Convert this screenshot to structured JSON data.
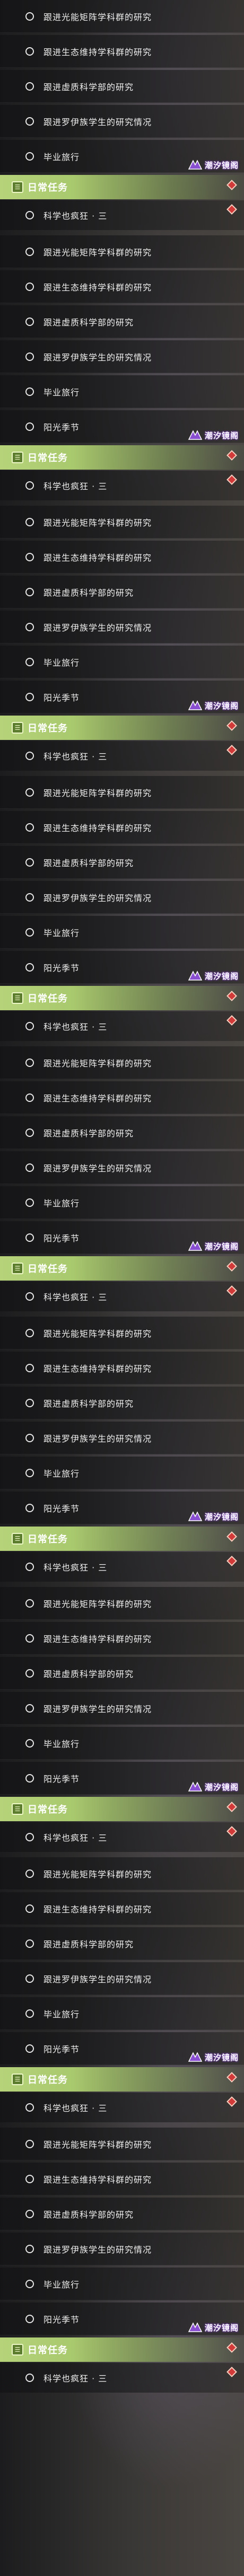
{
  "blocks": [
    {
      "tasks": [
        "跟进光能矩阵学科群的研究",
        "跟进生态维持学科群的研究",
        "跟进虚质科学部的研究",
        "跟进罗伊族学生的研究情况",
        "毕业旅行"
      ],
      "header": {
        "icon": "task-book-icon",
        "title": "日常任务"
      },
      "subtask": "科学也疯狂 · 三",
      "watermark": "潮汐镜阁",
      "show_spring": false
    },
    {
      "tasks": [
        "跟进光能矩阵学科群的研究",
        "跟进生态维持学科群的研究",
        "跟进虚质科学部的研究",
        "跟进罗伊族学生的研究情况",
        "毕业旅行",
        "阳光季节"
      ],
      "header": {
        "icon": "task-book-icon",
        "title": "日常任务"
      },
      "subtask": "科学也疯狂 · 三",
      "watermark": "潮汐镜阁",
      "show_spring": true
    },
    {
      "tasks": [
        "跟进光能矩阵学科群的研究",
        "跟进生态维持学科群的研究",
        "跟进虚质科学部的研究",
        "跟进罗伊族学生的研究情况",
        "毕业旅行",
        "阳光季节"
      ],
      "header": {
        "icon": "task-book-icon",
        "title": "日常任务"
      },
      "subtask": "科学也疯狂 · 三",
      "watermark": "潮汐镜阁",
      "show_spring": true
    },
    {
      "tasks": [
        "跟进光能矩阵学科群的研究",
        "跟进生态维持学科群的研究",
        "跟进虚质科学部的研究",
        "跟进罗伊族学生的研究情况",
        "毕业旅行",
        "阳光季节"
      ],
      "header": {
        "icon": "task-book-icon",
        "title": "日常任务"
      },
      "subtask": "科学也疯狂 · 三",
      "watermark": "潮汐镜阁",
      "show_spring": true
    },
    {
      "tasks": [
        "跟进光能矩阵学科群的研究",
        "跟进生态维持学科群的研究",
        "跟进虚质科学部的研究",
        "跟进罗伊族学生的研究情况",
        "毕业旅行",
        "阳光季节"
      ],
      "header": {
        "icon": "task-book-icon",
        "title": "日常任务"
      },
      "subtask": "科学也疯狂 · 三",
      "watermark": "潮汐镜阁",
      "show_spring": true
    },
    {
      "tasks": [
        "跟进光能矩阵学科群的研究",
        "跟进生态维持学科群的研究",
        "跟进虚质科学部的研究",
        "跟进罗伊族学生的研究情况",
        "毕业旅行",
        "阳光季节"
      ],
      "header": {
        "icon": "task-book-icon",
        "title": "日常任务"
      },
      "subtask": "科学也疯狂 · 三",
      "watermark": "潮汐镜阁",
      "show_spring": true
    },
    {
      "tasks": [
        "跟进光能矩阵学科群的研究",
        "跟进生态维持学科群的研究",
        "跟进虚质科学部的研究",
        "跟进罗伊族学生的研究情况",
        "毕业旅行",
        "阳光季节"
      ],
      "header": {
        "icon": "task-book-icon",
        "title": "日常任务"
      },
      "subtask": "科学也疯狂 · 三",
      "watermark": "潮汐镜阁",
      "show_spring": true
    },
    {
      "tasks": [
        "跟进光能矩阵学科群的研究",
        "跟进生态维持学科群的研究",
        "跟进虚质科学部的研究",
        "跟进罗伊族学生的研究情况",
        "毕业旅行",
        "阳光季节"
      ],
      "header": {
        "icon": "task-book-icon",
        "title": "日常任务"
      },
      "subtask": "科学也疯狂 · 三",
      "watermark": "潮汐镜阁",
      "show_spring": true
    },
    {
      "tasks": [
        "跟进光能矩阵学科群的研究",
        "跟进生态维持学科群的研究",
        "跟进虚质科学部的研究",
        "跟进罗伊族学生的研究情况",
        "毕业旅行",
        "阳光季节"
      ],
      "header": {
        "icon": "task-book-icon",
        "title": "日常任务"
      },
      "subtask": "科学也疯狂 · 三",
      "watermark": "潮汐镜阁",
      "show_spring": true
    }
  ],
  "colors": {
    "header_green": "#b6d37a",
    "marker_red": "#d23a3a",
    "watermark_glow": "#7a3fbf",
    "text": "#f0f0f0"
  }
}
